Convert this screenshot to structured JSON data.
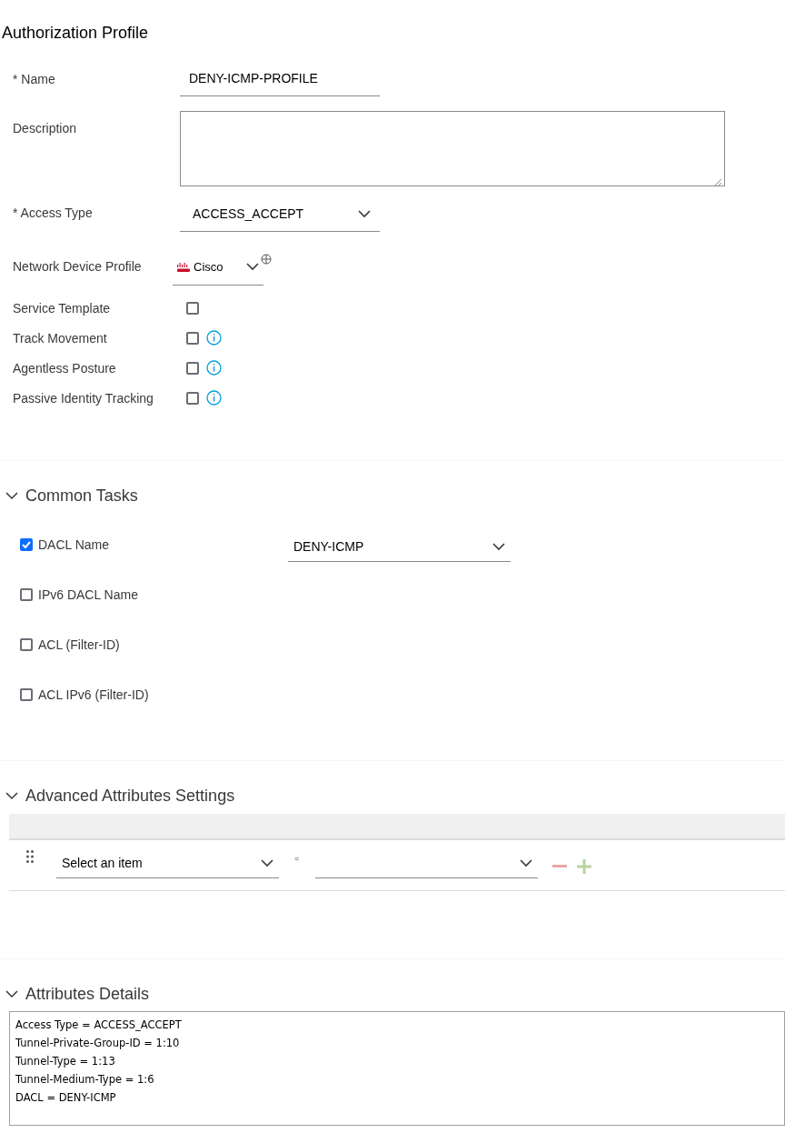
{
  "title": "Authorization Profile",
  "fields": [
    {
      "kind": "text",
      "label": "* Name",
      "value": "DENY-ICMP-PROFILE"
    },
    {
      "kind": "textarea",
      "label": "Description"
    },
    {
      "kind": "select",
      "label": "* Access Type",
      "value": "ACCESS_ACCEPT"
    },
    {
      "kind": "device",
      "label": "Network Device Profile",
      "value": "Cisco"
    }
  ],
  "options": [
    {
      "label": "Service Template",
      "checked": false,
      "info": false
    },
    {
      "label": "Track Movement",
      "checked": false,
      "info": true
    },
    {
      "label": "Agentless Posture",
      "checked": false,
      "info": true
    },
    {
      "label": "Passive Identity Tracking",
      "checked": false,
      "info": true
    }
  ],
  "common_tasks": {
    "title": "Common Tasks",
    "expanded": true,
    "items": [
      {
        "label": "DACL Name",
        "checked": true,
        "value": "DENY-ICMP"
      },
      {
        "label": "IPv6 DACL Name",
        "checked": false
      },
      {
        "label": "ACL  (Filter-ID)",
        "checked": false
      },
      {
        "label": "ACL IPv6 (Filter-ID)",
        "checked": false
      }
    ]
  },
  "advanced": {
    "title": "Advanced Attributes Settings",
    "expanded": true,
    "rows": [
      {
        "attribute": "Select an item",
        "operator": "="
      }
    ]
  },
  "details": {
    "title": "Attributes Details",
    "expanded": true,
    "lines": [
      "Access Type = ACCESS_ACCEPT",
      "Tunnel-Private-Group-ID = 1:10",
      "Tunnel-Type = 1:13",
      "Tunnel-Medium-Type = 1:6",
      "DACL = DENY-ICMP"
    ]
  }
}
